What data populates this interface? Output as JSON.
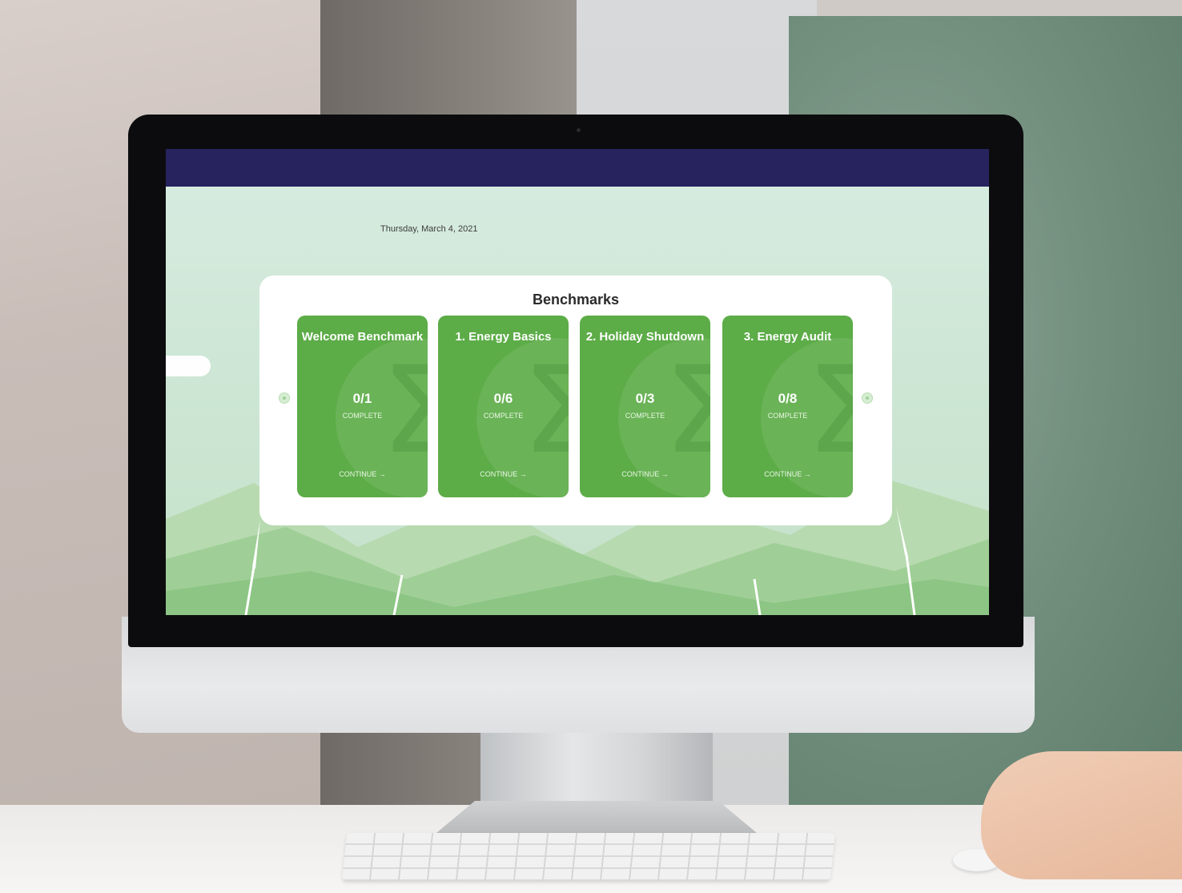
{
  "screen": {
    "date": "Thursday, March 4, 2021",
    "benchmarks": {
      "title": "Benchmarks",
      "cards": [
        {
          "title": "Welcome Benchmark",
          "progress": "0/1",
          "status": "COMPLETE",
          "action": "CONTINUE →"
        },
        {
          "title": "1. Energy Basics",
          "progress": "0/6",
          "status": "COMPLETE",
          "action": "CONTINUE →"
        },
        {
          "title": "2. Holiday Shutdown",
          "progress": "0/3",
          "status": "COMPLETE",
          "action": "CONTINUE →"
        },
        {
          "title": "3. Energy Audit",
          "progress": "0/8",
          "status": "COMPLETE",
          "action": "CONTINUE →"
        }
      ]
    }
  },
  "colors": {
    "topbar": "#26235f",
    "card": "#5cac47",
    "panel": "#ffffff"
  },
  "icons": [
    "carousel-prev-icon",
    "carousel-next-icon",
    "arrow-right-icon"
  ]
}
